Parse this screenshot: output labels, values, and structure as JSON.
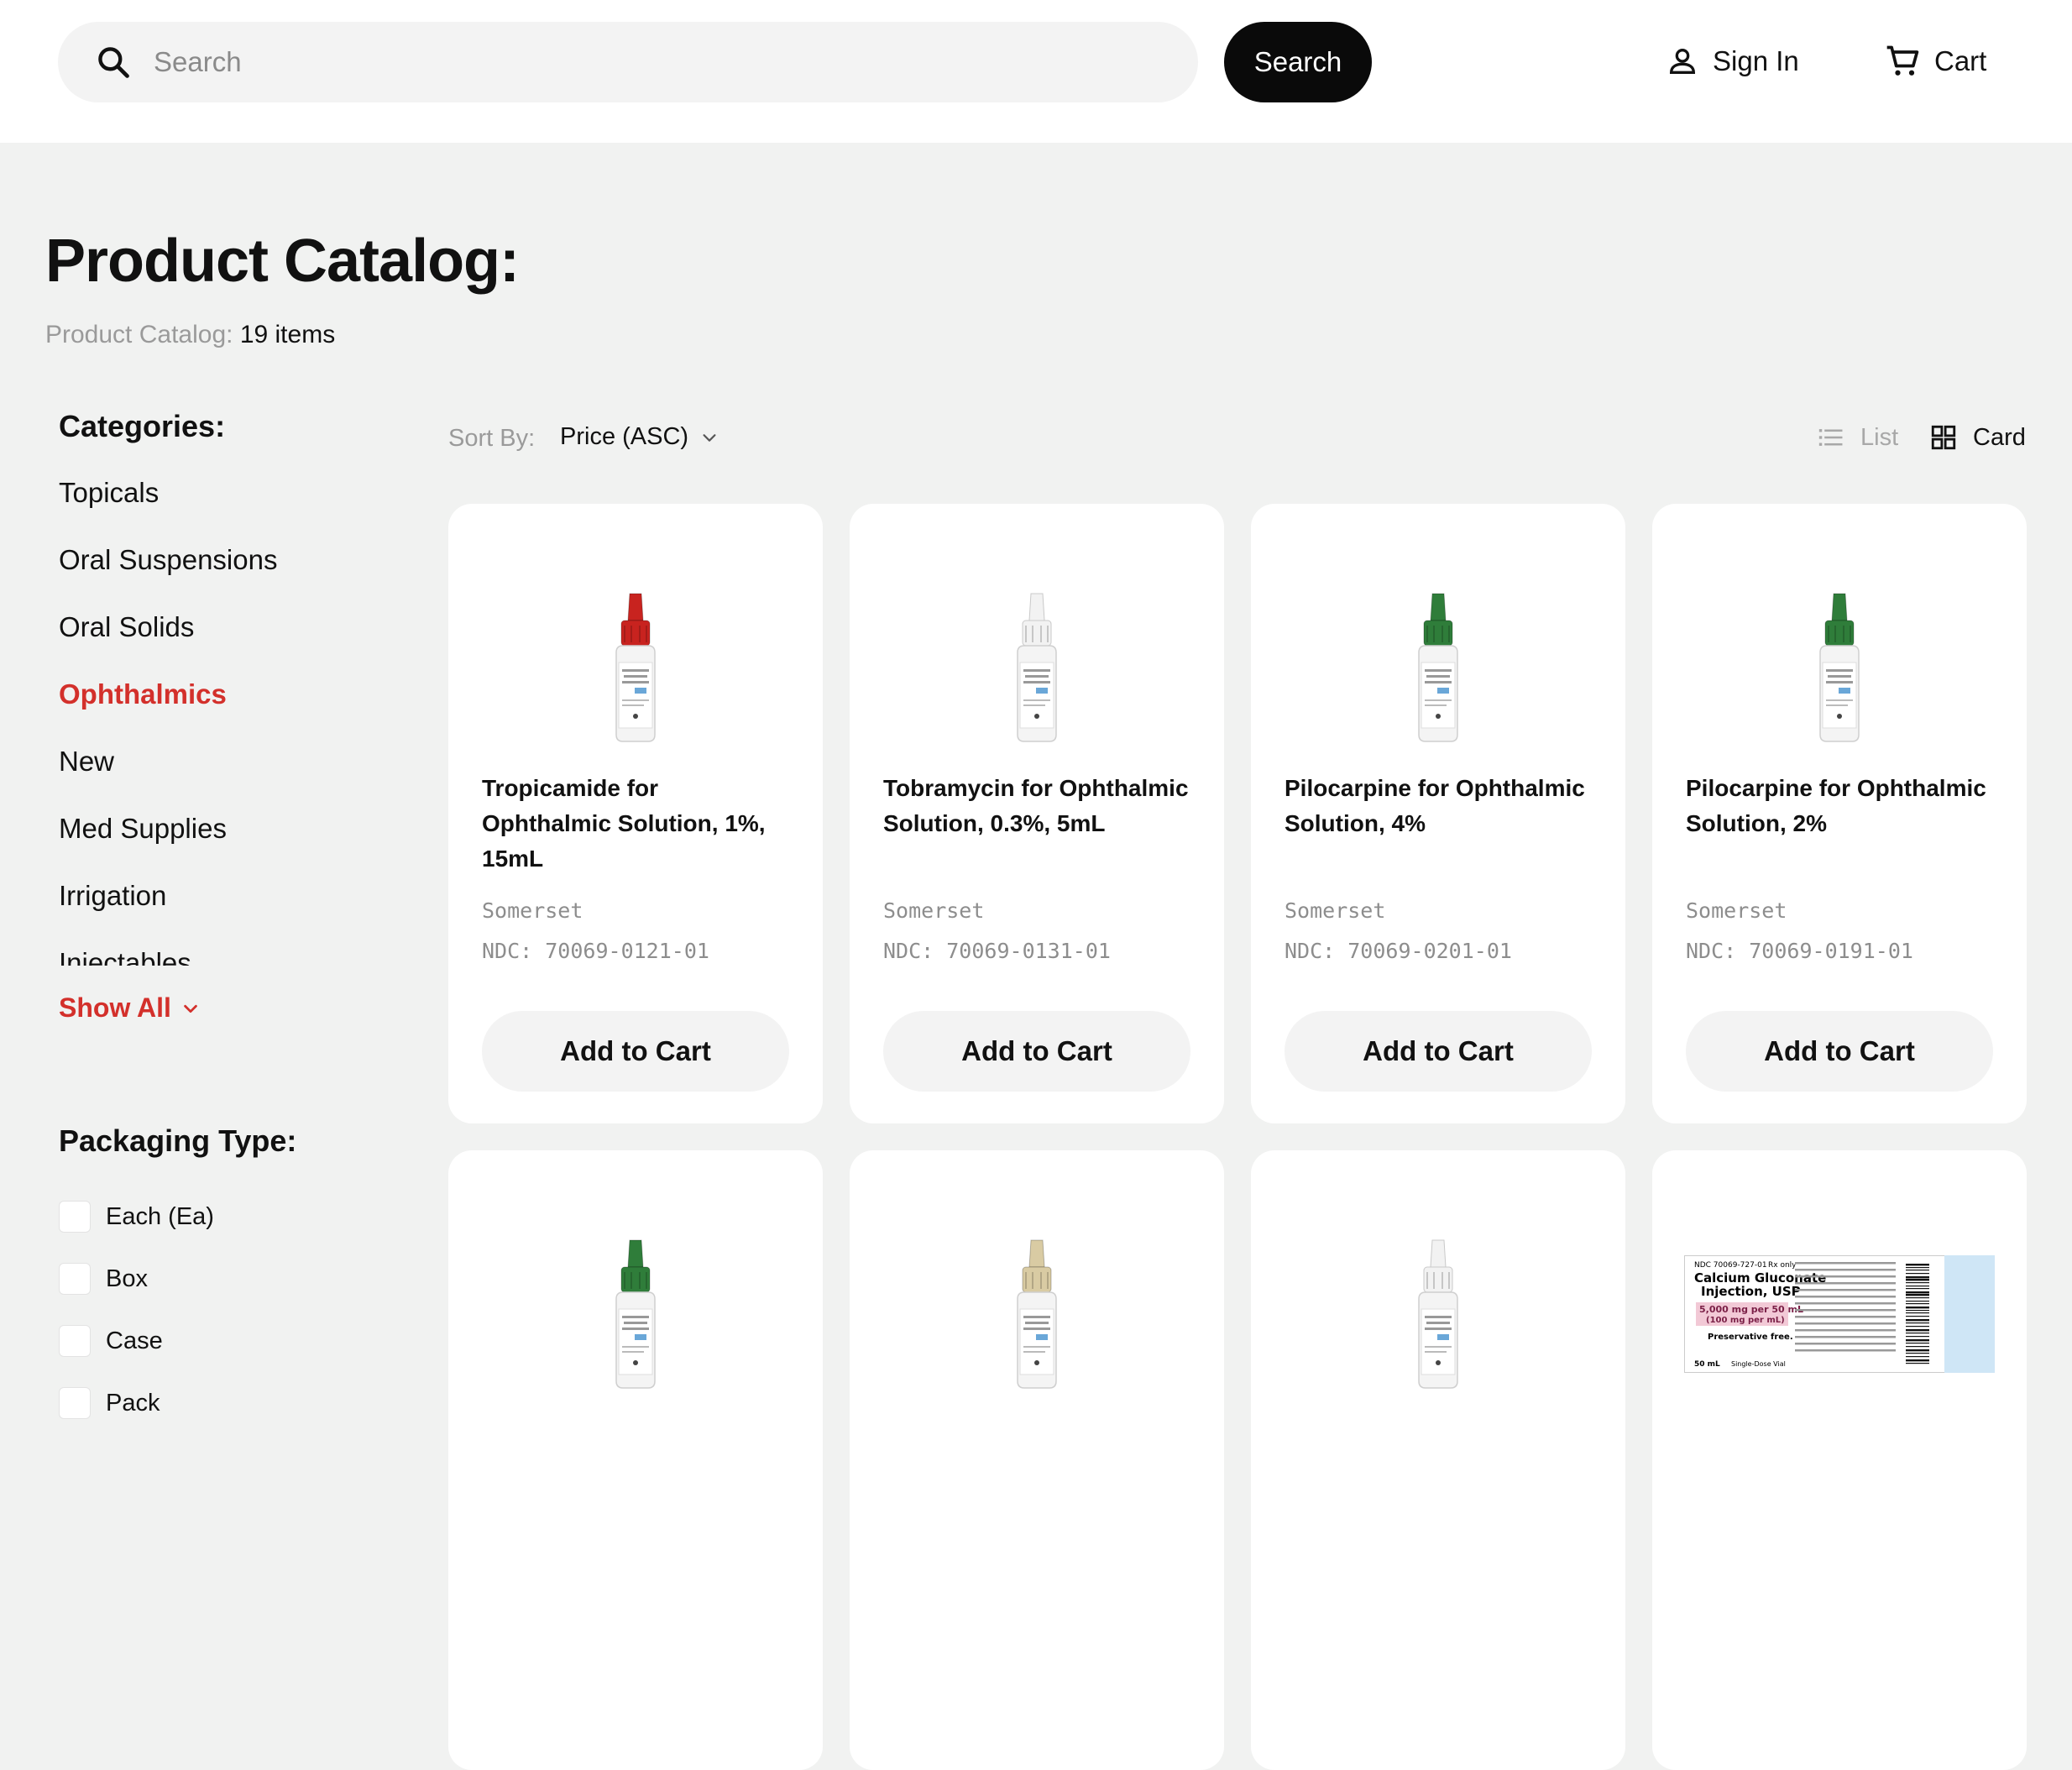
{
  "header": {
    "search_placeholder": "Search",
    "search_button": "Search",
    "sign_in": "Sign In",
    "cart": "Cart"
  },
  "page": {
    "title": "Product Catalog:",
    "crumb_label": "Product Catalog:",
    "crumb_count": "19 items"
  },
  "sidebar": {
    "categories_heading": "Categories:",
    "categories": [
      {
        "label": "Topicals",
        "active": false
      },
      {
        "label": "Oral Suspensions",
        "active": false
      },
      {
        "label": "Oral Solids",
        "active": false
      },
      {
        "label": "Ophthalmics",
        "active": true
      },
      {
        "label": "New",
        "active": false
      },
      {
        "label": "Med Supplies",
        "active": false
      },
      {
        "label": "Irrigation",
        "active": false
      },
      {
        "label": "Injectables",
        "active": false
      }
    ],
    "show_all": "Show All",
    "packaging_heading": "Packaging Type:",
    "packaging": [
      "Each (Ea)",
      "Box",
      "Case",
      "Pack"
    ]
  },
  "toolbar": {
    "sort_label": "Sort By:",
    "sort_value": "Price (ASC)",
    "view_list": "List",
    "view_card": "Card"
  },
  "products": [
    {
      "name": "Tropicamide for Ophthalmic Solution, 1%, 15mL",
      "brand": "Somerset",
      "ndc": "NDC: 70069-0121-01",
      "cap": "#c8231f",
      "add": "Add to Cart"
    },
    {
      "name": "Tobramycin for Ophthalmic Solution, 0.3%, 5mL",
      "brand": "Somerset",
      "ndc": "NDC: 70069-0131-01",
      "cap": "#f2f2f2",
      "add": "Add to Cart"
    },
    {
      "name": "Pilocarpine for Ophthalmic Solution, 4%",
      "brand": "Somerset",
      "ndc": "NDC: 70069-0201-01",
      "cap": "#2f7d3a",
      "add": "Add to Cart"
    },
    {
      "name": "Pilocarpine for Ophthalmic Solution, 2%",
      "brand": "Somerset",
      "ndc": "NDC: 70069-0191-01",
      "cap": "#2f7d3a",
      "add": "Add to Cart"
    },
    {
      "name": "",
      "brand": "",
      "ndc": "",
      "cap": "#2f7d3a",
      "add": ""
    },
    {
      "name": "",
      "brand": "",
      "ndc": "",
      "cap": "#d9cba3",
      "add": ""
    },
    {
      "name": "",
      "brand": "",
      "ndc": "",
      "cap": "#f2f2f2",
      "add": ""
    },
    {
      "name": "",
      "brand": "",
      "ndc": "",
      "cap": "label",
      "add": "",
      "label_lines": [
        "NDC 70069-727-01",
        "Rx only",
        "Calcium Gluconate",
        "Injection, USP",
        "5,000 mg per 50 mL",
        "(100 mg per mL)",
        "Preservative free.",
        "50 mL",
        "Single-Dose Vial"
      ]
    }
  ]
}
